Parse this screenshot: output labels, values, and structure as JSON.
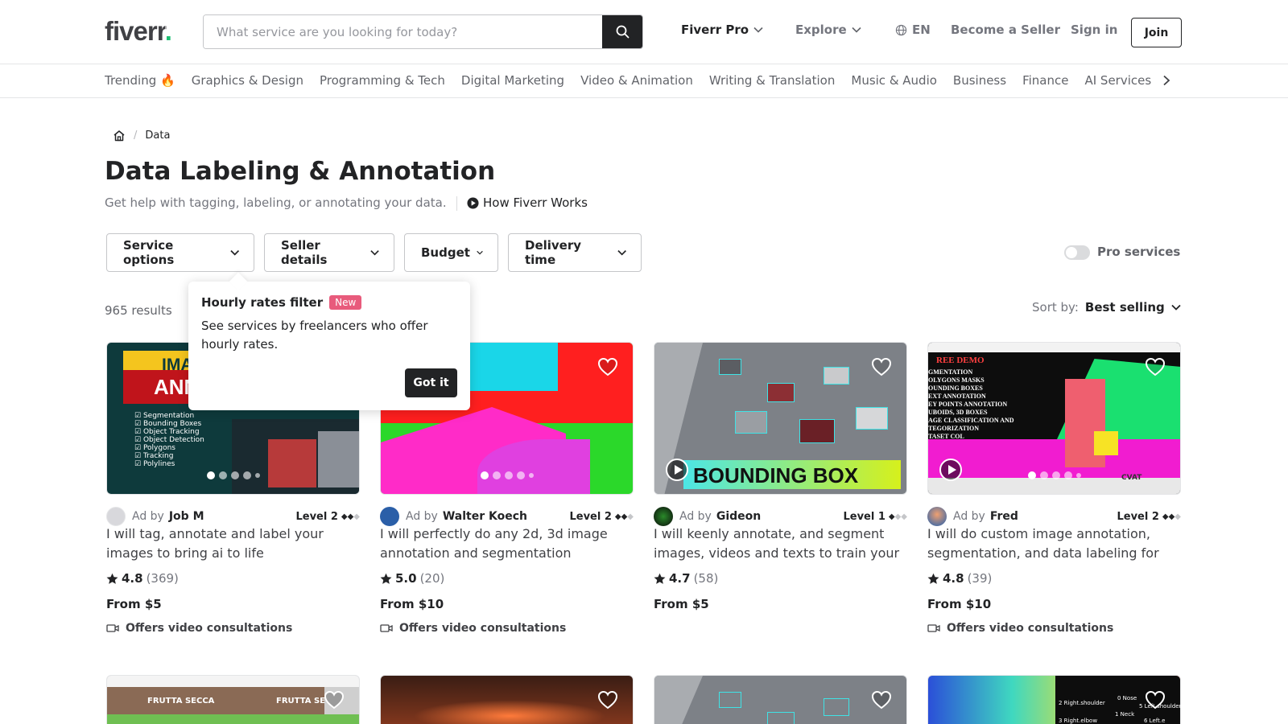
{
  "header": {
    "logo": "fiverr",
    "search_placeholder": "What service are you looking for today?",
    "nav": {
      "fiverr_pro": "Fiverr Pro",
      "explore": "Explore",
      "language": "EN",
      "become_seller": "Become a Seller",
      "sign_in": "Sign in",
      "join": "Join"
    }
  },
  "categories": [
    "Trending 🔥",
    "Graphics & Design",
    "Programming & Tech",
    "Digital Marketing",
    "Video & Animation",
    "Writing & Translation",
    "Music & Audio",
    "Business",
    "Finance",
    "AI Services"
  ],
  "breadcrumb": {
    "current": "Data"
  },
  "page": {
    "title": "Data Labeling & Annotation",
    "subtitle": "Get help with tagging, labeling, or annotating your data.",
    "how_it_works": "How Fiverr Works"
  },
  "filters": {
    "service_options": "Service options",
    "seller_details": "Seller details",
    "budget": "Budget",
    "delivery_time": "Delivery time",
    "pro_services": "Pro services"
  },
  "results": {
    "count": "965 results",
    "sort_label": "Sort by:",
    "sort_value": "Best selling"
  },
  "popover": {
    "title": "Hourly rates filter",
    "badge": "New",
    "text": "See services by freelancers who offer hourly rates.",
    "button": "Got it"
  },
  "gigs": [
    {
      "ad_by": "Ad by",
      "seller": "Job M",
      "level": "Level 2",
      "title": "I will tag, annotate and label your images to bring ai to life",
      "rating": "4.8",
      "reviews": "(369)",
      "price": "From $5",
      "video": "Offers video consultations",
      "thumb_text_1": "IMAG",
      "thumb_text_2": "ANNO",
      "thumb_list": [
        "Segmentation",
        "Bounding Boxes",
        "Object Tracking",
        "Object Detection",
        "Polygons",
        "Tracking",
        "Polylines"
      ]
    },
    {
      "ad_by": "Ad by",
      "seller": "Walter Koech",
      "level": "Level 2",
      "title": "I will perfectly do any 2d, 3d image annotation and segmentation",
      "rating": "5.0",
      "reviews": "(20)",
      "price": "From $10",
      "video": "Offers video consultations"
    },
    {
      "ad_by": "Ad by",
      "seller": "Gideon",
      "level": "Level 1",
      "title": "I will keenly annotate, and segment images, videos and texts to train your ...",
      "rating": "4.7",
      "reviews": "(58)",
      "price": "From $5",
      "thumb_text": "BOUNDING BOX"
    },
    {
      "ad_by": "Ad by",
      "seller": "Fred",
      "level": "Level 2",
      "title": "I will do custom image annotation, segmentation, and data labeling for ai,...",
      "rating": "4.8",
      "reviews": "(39)",
      "price": "From $10",
      "video": "Offers video consultations",
      "thumb_title": "REE DEMO",
      "thumb_list": [
        "GMENTATION",
        "OLYGONS MASKS",
        "OUNDING BOXES",
        "EXT ANNOTATION",
        "EY POINTS ANNOTATION",
        "UBOIDS, 3D BOXES",
        "AGE CLASSIFICATION AND",
        "TEGORIZATION",
        "TASET COL"
      ],
      "thumb_logo": "CVAT"
    }
  ],
  "row2_thumbs": {
    "card1_text_1": "FRUTTA SECCA",
    "card1_text_2": "FRUTTA SE",
    "card4_labels": [
      "2 Right.shoulder",
      "0 Nose",
      "5 Left.shoulder",
      "1 Neck",
      "3 Right.elbow",
      "6 Left.e"
    ]
  },
  "colors": {
    "brand_green": "#1dbf73",
    "badge_pink": "#e85b7c",
    "dark": "#222325"
  }
}
